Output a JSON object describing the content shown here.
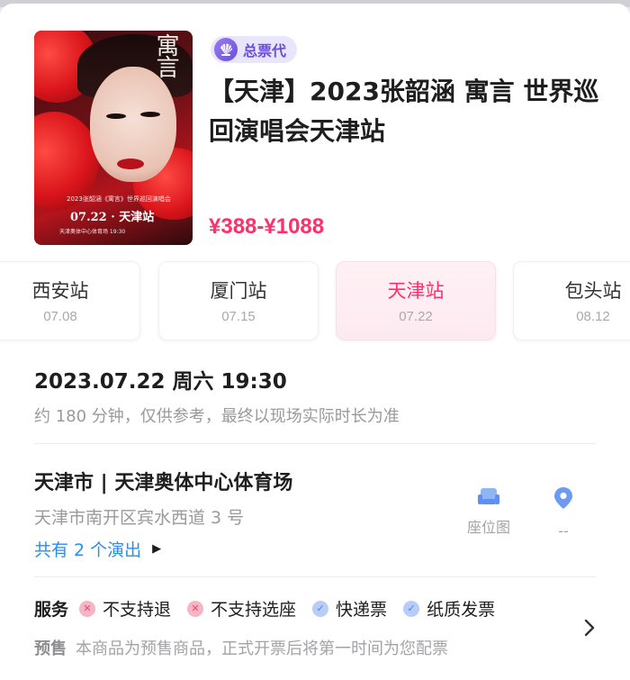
{
  "event": {
    "agent_badge": "总票代",
    "title": "【天津】2023张韶涵 寓言 世界巡回演唱会天津站",
    "price_range": "¥388-¥1088",
    "poster": {
      "title_glyphs": "寓言",
      "tour_text": "2023张韶涵《寓言》世界巡回演唱会",
      "date_text": "07.22 · 天津站",
      "footer_text": "天津奥体中心体育场 19:30"
    }
  },
  "stations": [
    {
      "name": "西安站",
      "date": "07.08",
      "selected": false
    },
    {
      "name": "厦门站",
      "date": "07.15",
      "selected": false
    },
    {
      "name": "天津站",
      "date": "07.22",
      "selected": true
    },
    {
      "name": "包头站",
      "date": "08.12",
      "selected": false
    }
  ],
  "schedule": {
    "datetime": "2023.07.22 周六 19:30",
    "duration_note": "约 180 分钟，仅供参考，最终以现场实际时长为准"
  },
  "venue": {
    "name": "天津市 | 天津奥体中心体育场",
    "address": "天津市南开区宾水西道 3 号",
    "shows_link": "共有 2 个演出",
    "seatmap_label": "座位图",
    "distance_label": "--"
  },
  "services": {
    "label": "服务",
    "items": [
      {
        "text": "不支持退",
        "status": "no",
        "icon": "x-circle-icon"
      },
      {
        "text": "不支持选座",
        "status": "no",
        "icon": "x-circle-icon"
      },
      {
        "text": "快递票",
        "status": "yes",
        "icon": "check-circle-icon"
      },
      {
        "text": "纸质发票",
        "status": "yes",
        "icon": "check-circle-icon"
      }
    ],
    "presale_label": "预售",
    "presale_text": "本商品为预售商品，正式开票后将第一时间为您配票"
  },
  "colors": {
    "accent_pink": "#ff2f6b",
    "link_blue": "#2b8cf0",
    "badge_purple": "#6a4fd8"
  }
}
